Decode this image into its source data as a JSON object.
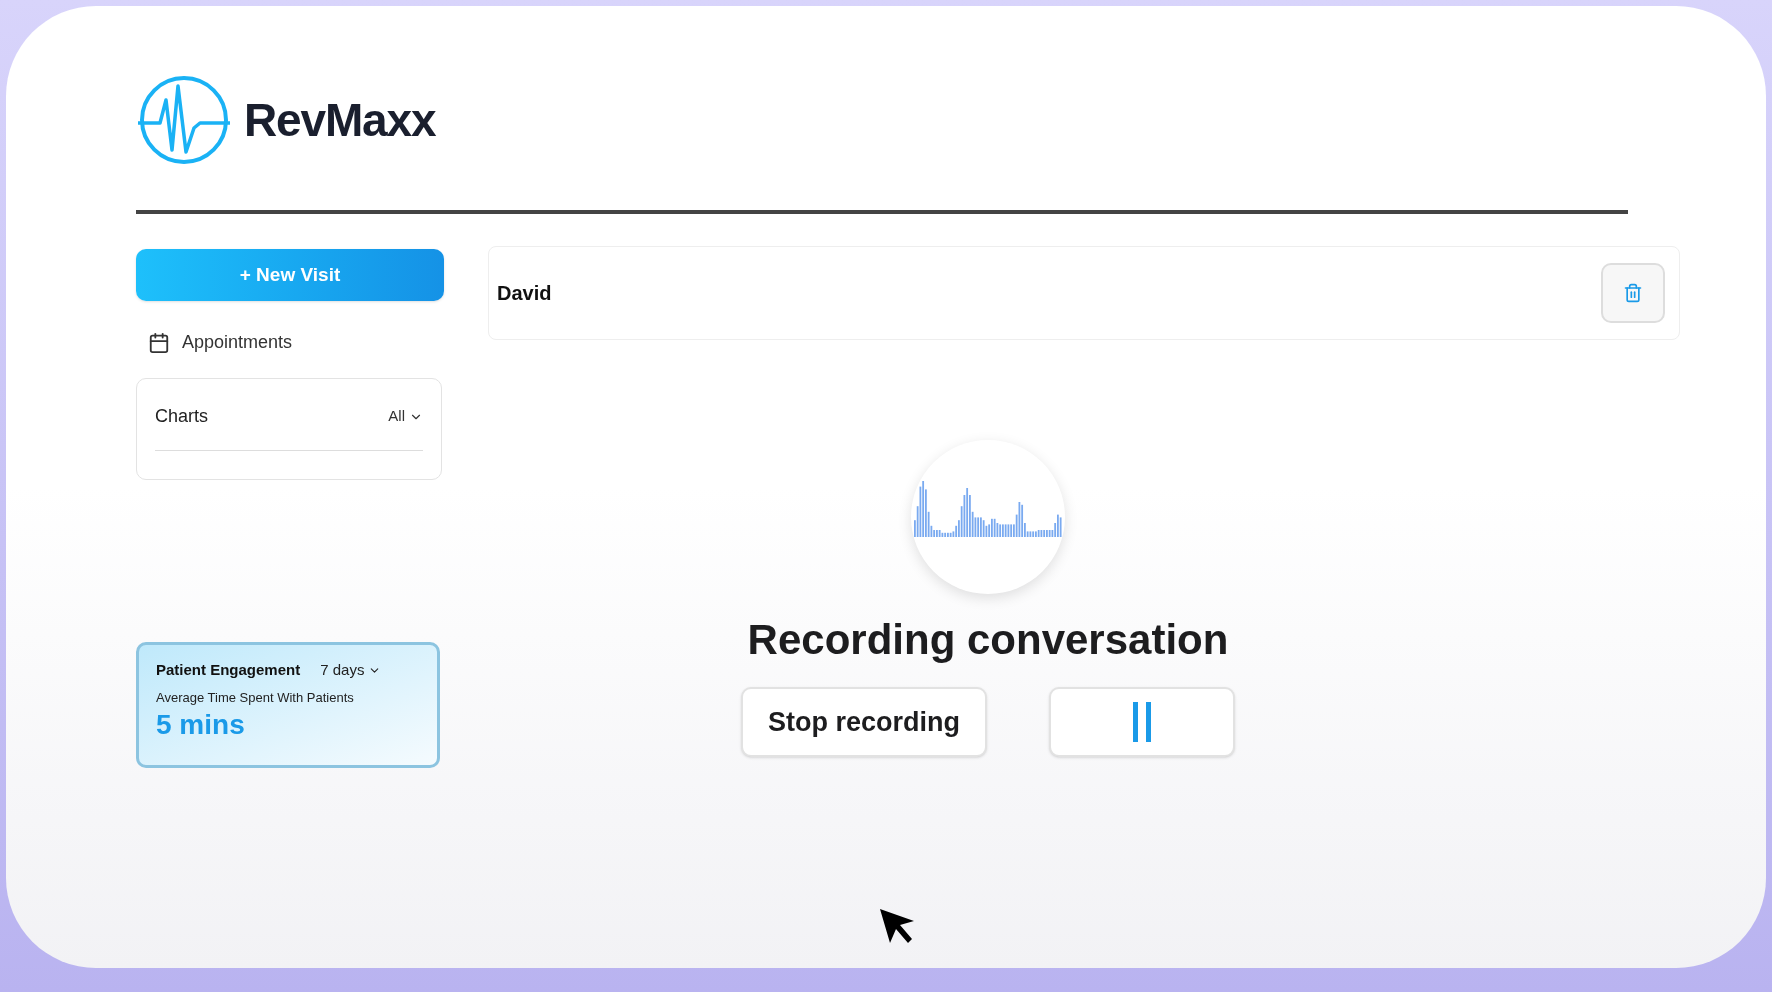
{
  "brand": {
    "name": "RevMaxx"
  },
  "sidebar": {
    "new_visit_button": "+ New Visit",
    "nav_items": [
      {
        "label": "Appointments",
        "selected": false
      }
    ],
    "charts_card": {
      "title": "Charts",
      "filter": "All"
    },
    "engagement_card": {
      "title": "Patient Engagement",
      "period": "7 days",
      "metric_label": "Average Time Spent With Patients",
      "value": "5 mins"
    }
  },
  "visit": {
    "patient_name": "David"
  },
  "recording": {
    "title": "Recording conversation",
    "stop_button": "Stop recording"
  }
}
